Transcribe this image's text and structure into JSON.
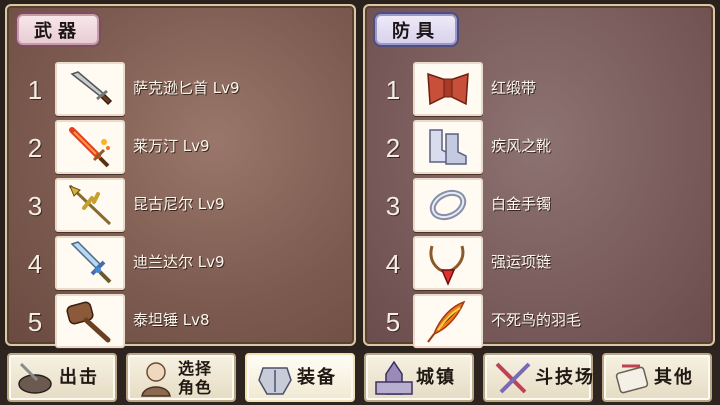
{
  "weapons": {
    "tab": "武器",
    "items": [
      {
        "rank": "1",
        "name": "萨克逊匕首 Lv9",
        "icon": "dagger-icon"
      },
      {
        "rank": "2",
        "name": "莱万汀 Lv9",
        "icon": "fire-sword-icon"
      },
      {
        "rank": "3",
        "name": "昆古尼尔 Lv9",
        "icon": "spear-icon"
      },
      {
        "rank": "4",
        "name": "迪兰达尔 Lv9",
        "icon": "ice-sword-icon"
      },
      {
        "rank": "5",
        "name": "泰坦锤 Lv8",
        "icon": "hammer-icon"
      }
    ]
  },
  "armor": {
    "tab": "防具",
    "items": [
      {
        "rank": "1",
        "name": "红缎带",
        "icon": "red-ribbon-icon"
      },
      {
        "rank": "2",
        "name": "疾风之靴",
        "icon": "boots-icon"
      },
      {
        "rank": "3",
        "name": "白金手镯",
        "icon": "bracelet-icon"
      },
      {
        "rank": "4",
        "name": "强运项链",
        "icon": "necklace-icon"
      },
      {
        "rank": "5",
        "name": "不死鸟的羽毛",
        "icon": "phoenix-feather-icon"
      }
    ]
  },
  "nav": [
    {
      "label": "出击",
      "icon": "sortie-icon"
    },
    {
      "label1": "选择",
      "label2": "角色",
      "icon": "character-icon"
    },
    {
      "label": "装备",
      "icon": "armor-icon",
      "active": true
    },
    {
      "label": "城镇",
      "icon": "town-icon"
    },
    {
      "label": "斗技场",
      "icon": "arena-icon"
    },
    {
      "label": "其他",
      "icon": "other-icon"
    }
  ]
}
